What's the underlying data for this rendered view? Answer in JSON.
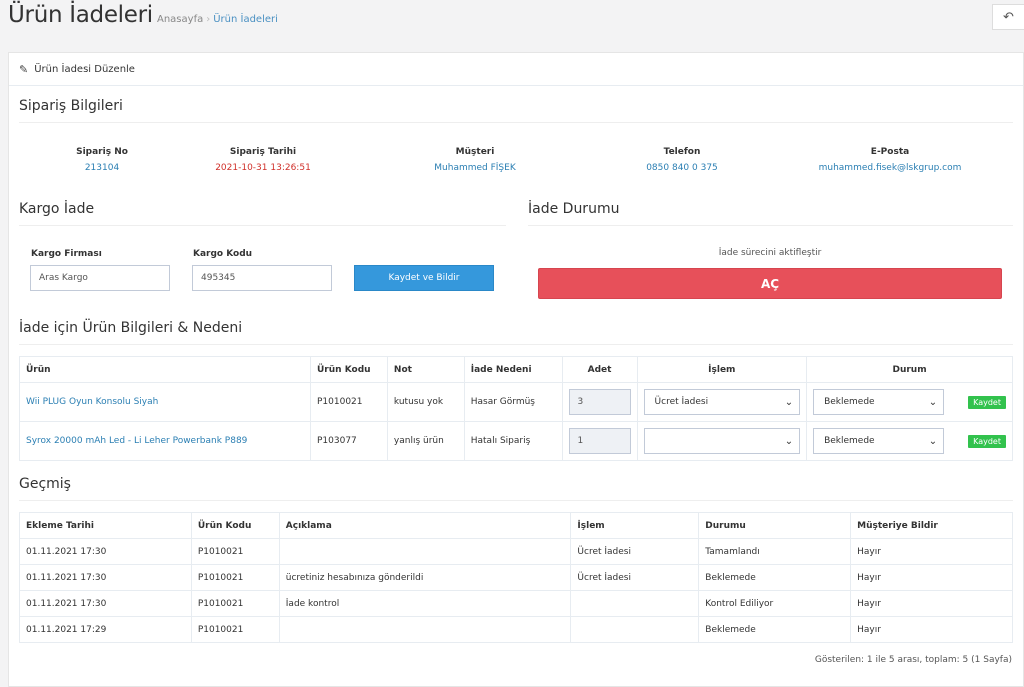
{
  "header": {
    "title": "Ürün İadeleri",
    "breadcrumb": [
      "Anasayfa",
      "Ürün İadeleri"
    ],
    "back_icon": "undo-icon"
  },
  "portlet": {
    "title": "Ürün İadesi Düzenle"
  },
  "order": {
    "section_title": "Sipariş Bilgileri",
    "fields": [
      {
        "label": "Sipariş No",
        "value": "213104"
      },
      {
        "label": "Sipariş Tarihi",
        "value": "2021-10-31 13:26:51"
      },
      {
        "label": "Müşteri",
        "value": "Muhammed FİŞEK"
      },
      {
        "label": "Telefon",
        "value": "0850 840 0 375"
      },
      {
        "label": "E-Posta",
        "value": "muhammed.fisek@lskgrup.com"
      }
    ]
  },
  "cargo": {
    "section_title": "Kargo İade",
    "company_label": "Kargo Firması",
    "company_value": "Aras Kargo",
    "code_label": "Kargo Kodu",
    "code_value": "495345",
    "save_button": "Kaydet ve Bildir"
  },
  "return_status": {
    "section_title": "İade Durumu",
    "hint": "İade sürecini aktifleştir",
    "button": "AÇ"
  },
  "products": {
    "section_title": "İade için Ürün Bilgileri & Nedeni",
    "headers": [
      "Ürün",
      "Ürün Kodu",
      "Not",
      "İade Nedeni",
      "Adet",
      "İşlem",
      "Durum"
    ],
    "rows": [
      {
        "name": "Wii PLUG Oyun Konsolu Siyah",
        "code": "P1010021",
        "note": "kutusu yok",
        "reason": "Hasar Görmüş",
        "qty": "3",
        "action": "Ücret İadesi",
        "status": "Beklemede",
        "save": "Kaydet"
      },
      {
        "name": "Syrox 20000 mAh Led - Li Leher Powerbank P889",
        "code": "P103077",
        "note": "yanlış ürün",
        "reason": "Hatalı Sipariş",
        "qty": "1",
        "action": "",
        "status": "Beklemede",
        "save": "Kaydet"
      }
    ]
  },
  "history": {
    "section_title": "Geçmiş",
    "headers": [
      "Ekleme Tarihi",
      "Ürün Kodu",
      "Açıklama",
      "İşlem",
      "Durumu",
      "Müşteriye Bildir"
    ],
    "rows": [
      {
        "date": "01.11.2021 17:30",
        "code": "P1010021",
        "desc": "",
        "action": "Ücret İadesi",
        "status": "Tamamlandı",
        "notify": "Hayır"
      },
      {
        "date": "01.11.2021 17:30",
        "code": "P1010021",
        "desc": "ücretiniz hesabınıza gönderildi",
        "action": "Ücret İadesi",
        "status": "Beklemede",
        "notify": "Hayır"
      },
      {
        "date": "01.11.2021 17:30",
        "code": "P1010021",
        "desc": "İade kontrol",
        "action": "",
        "status": "Kontrol Ediliyor",
        "notify": "Hayır"
      },
      {
        "date": "01.11.2021 17:29",
        "code": "P1010021",
        "desc": "",
        "action": "",
        "status": "Beklemede",
        "notify": "Hayır"
      }
    ],
    "footer": "Gösterilen: 1 ile 5 arası, toplam: 5 (1 Sayfa)"
  }
}
